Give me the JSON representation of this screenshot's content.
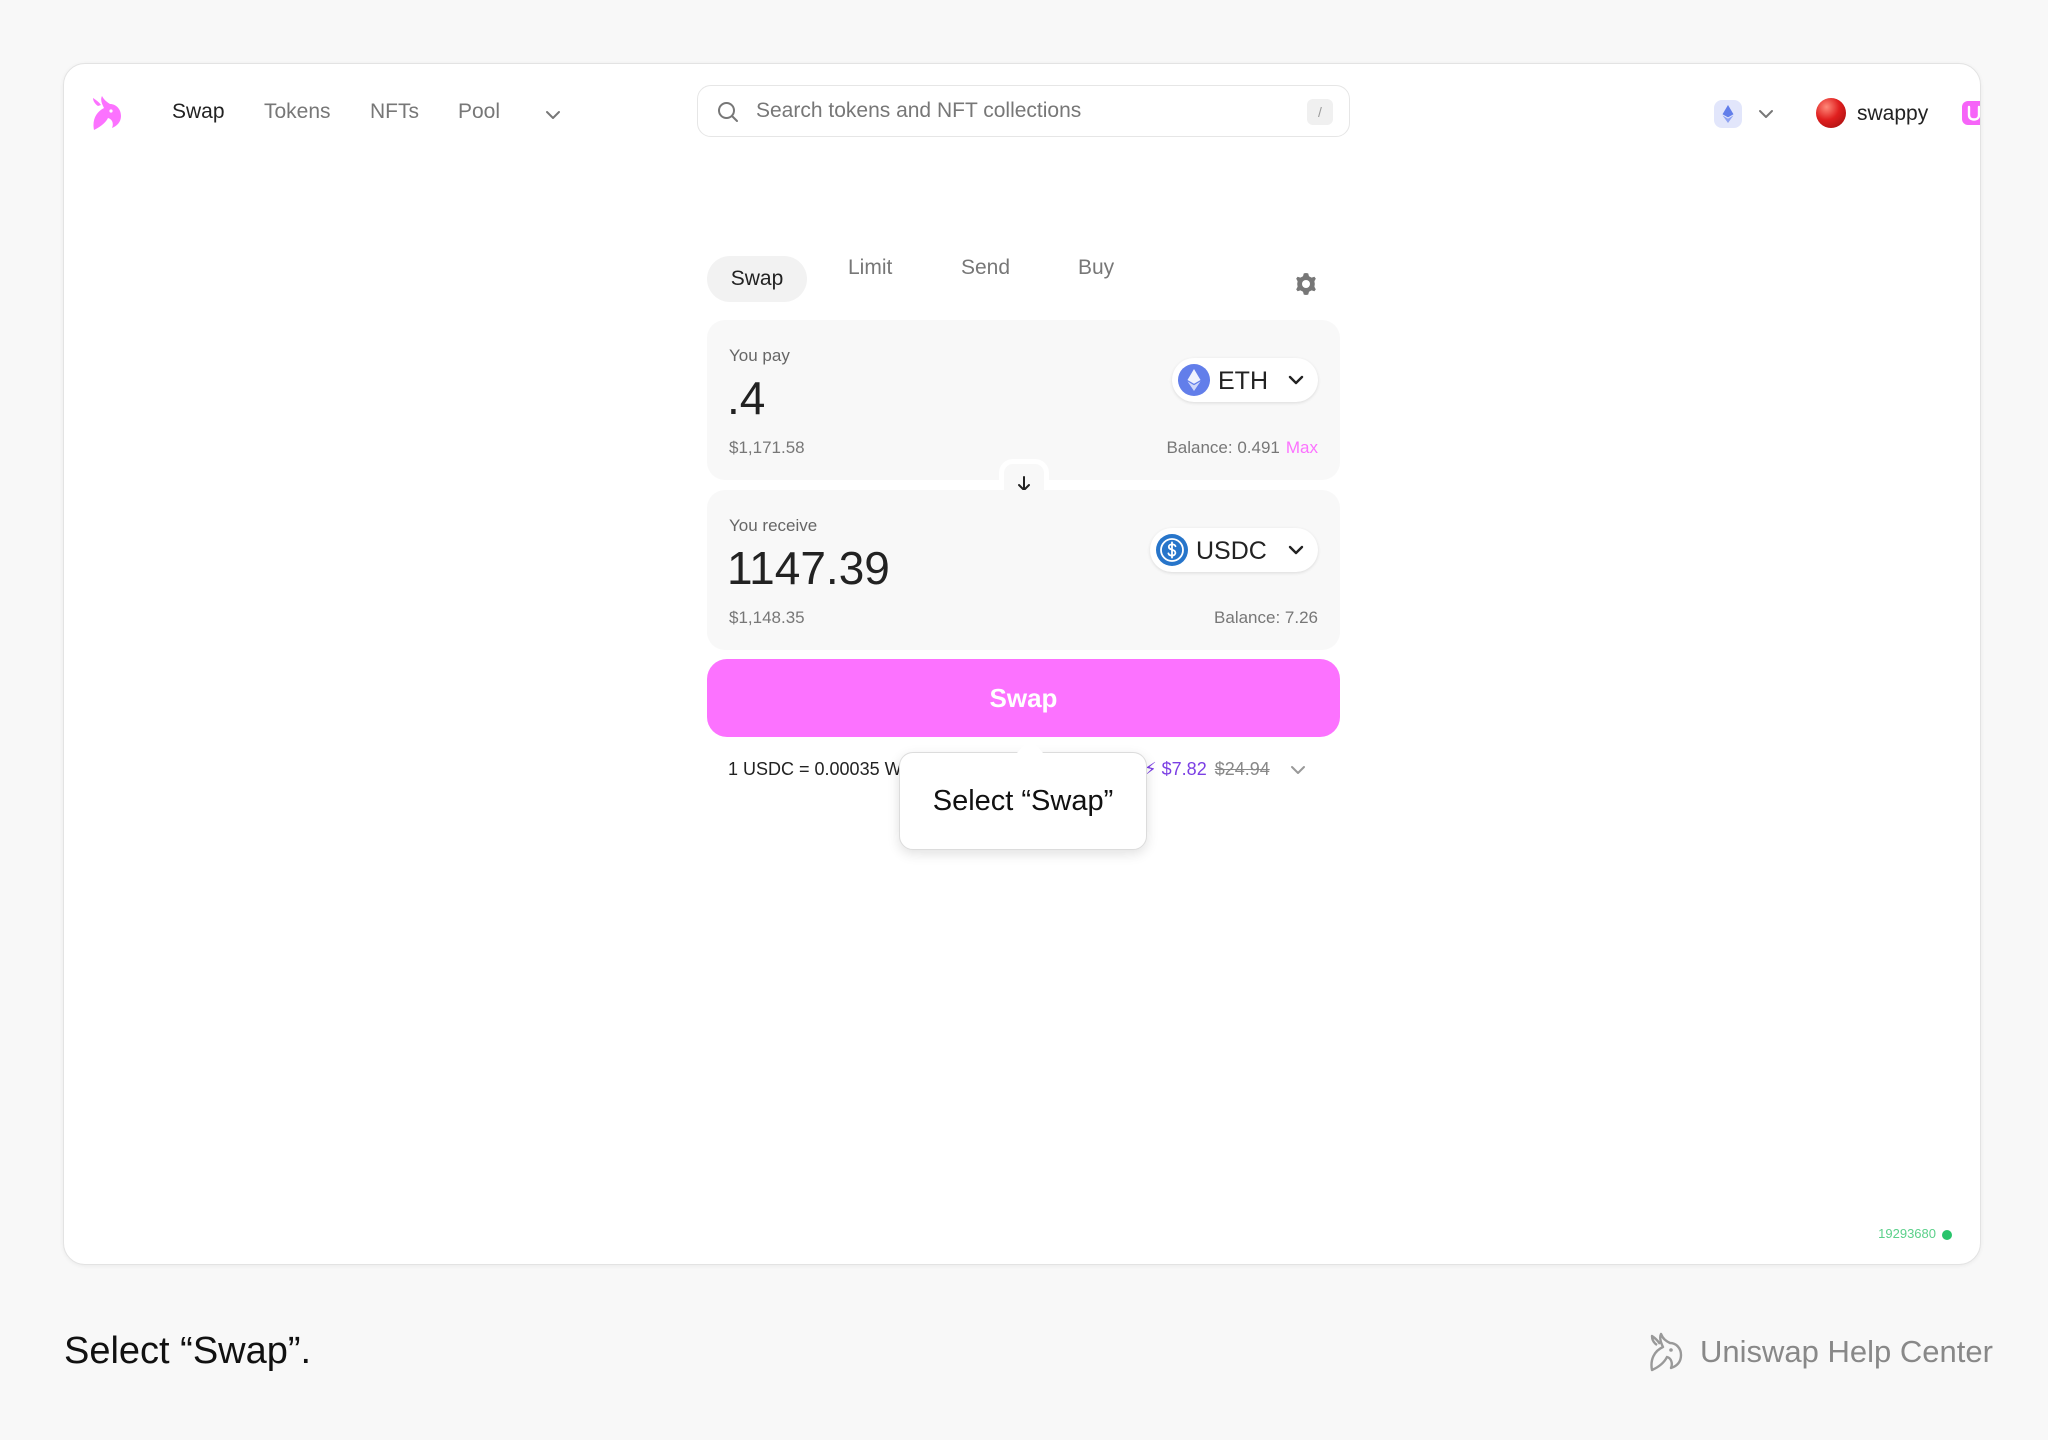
{
  "nav": {
    "links": [
      "Swap",
      "Tokens",
      "NFTs",
      "Pool"
    ],
    "active": "Swap"
  },
  "search": {
    "placeholder": "Search tokens and NFT collections",
    "shortcut": "/"
  },
  "network": {
    "icon": "ethereum-icon"
  },
  "account": {
    "name": "swappy"
  },
  "widget": {
    "tabs": [
      "Swap",
      "Limit",
      "Send",
      "Buy"
    ],
    "active_tab": "Swap",
    "pay": {
      "label": "You pay",
      "amount": ".4",
      "token": "ETH",
      "fiat": "$1,171.58",
      "balance": "Balance: 0.491",
      "max": "Max"
    },
    "receive": {
      "label": "You receive",
      "amount": "1147.39",
      "token": "USDC",
      "fiat": "$1,148.35",
      "balance": "Balance: 7.26"
    },
    "swap_button": "Swap",
    "rate": "1 USDC = 0.00035 W",
    "gas_new": "$7.82",
    "gas_old": "$24.94"
  },
  "tooltip": {
    "text": "Select “Swap”"
  },
  "block_number": "19293680",
  "caption": "Select “Swap”.",
  "brand": {
    "help_center": "Uniswap Help Center"
  },
  "colors": {
    "accent": "#fc72ff",
    "gas_purple": "#7b3fe4",
    "status_green": "#28c46b"
  }
}
